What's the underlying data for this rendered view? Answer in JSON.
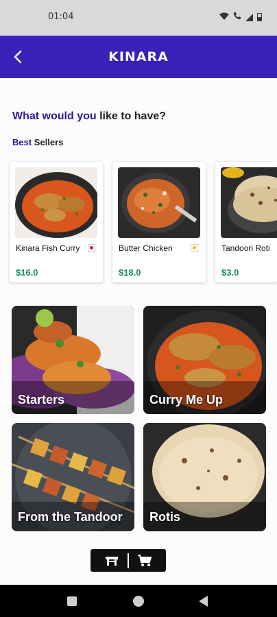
{
  "status": {
    "time": "01:04"
  },
  "header": {
    "title": "KINARA"
  },
  "prompt": {
    "accent": "What would you",
    "rest": " like to have?"
  },
  "best_sellers": {
    "accent": "Best",
    "rest": " Sellers"
  },
  "products": [
    {
      "name": "Kinara Fish Curry",
      "price": "$16.0",
      "badge_color": "#d81b1b"
    },
    {
      "name": "Butter Chicken",
      "price": "$18.0",
      "badge_color": "#f2c200"
    },
    {
      "name": "Tandoori Roti",
      "price": "$3.0"
    }
  ],
  "categories": [
    {
      "label": "Starters"
    },
    {
      "label": "Curry Me Up"
    },
    {
      "label": "From the Tandoor"
    },
    {
      "label": "Rotis"
    }
  ],
  "icons": {
    "back": "arrow-left-icon",
    "table": "restaurant-table-icon",
    "cart": "shopping-cart-icon"
  },
  "colors": {
    "brand": "#3a1fb8",
    "accent_text": "#2a1a9a",
    "price": "#1b8f5a"
  }
}
